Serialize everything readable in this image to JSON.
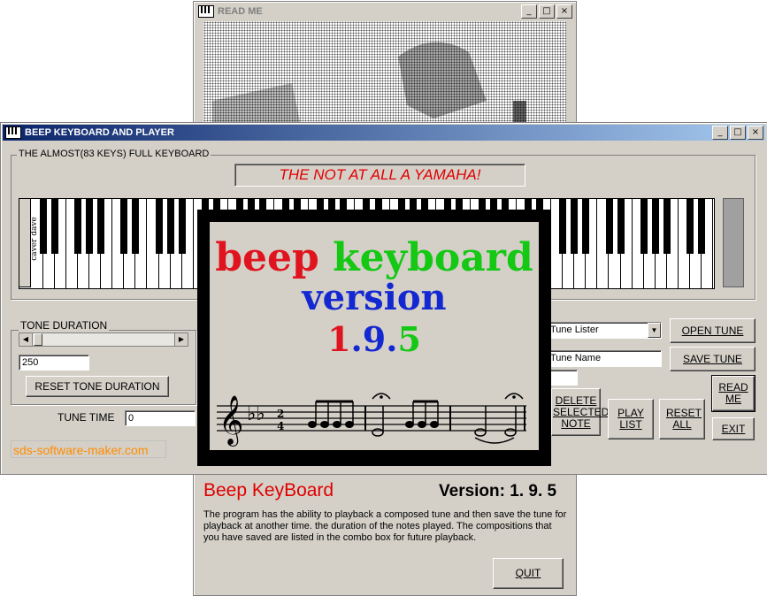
{
  "readme_window": {
    "title": "READ ME",
    "heading": "Beep KeyBoard",
    "version": "Version: 1. 9. 5",
    "description": "The program has the ability to playback a composed tune and then save the tune for playback at  another time.  the duration of the notes played.  The compositions that you have saved are listed in the combo box for future playback.",
    "quit_label": "QUIT"
  },
  "main_window": {
    "title": "BEEP KEYBOARD AND PLAYER",
    "keyboard_group_label": "THE ALMOST(83 KEYS) FULL KEYBOARD",
    "banner": "THE NOT AT ALL A YAMAHA!",
    "side_label": "caver dave",
    "tone_group_label": "TONE DURATION",
    "tone_value": "250",
    "reset_tone_label": "RESET TONE DURATION",
    "tune_time_label": "TUNE TIME",
    "tune_time_value": "0",
    "website": "sds-software-maker.com",
    "tune_lister_value": "Tune Lister",
    "tune_name_value": "Tune Name",
    "open_tune_label": "OPEN TUNE",
    "save_tune_label": "SAVE TUNE",
    "read_me_label": "READ ME",
    "delete_label": "DELETE SELECTED NOTE",
    "play_list_label": "PLAY LIST",
    "reset_all_label": "RESET ALL",
    "exit_label": "EXIT"
  },
  "splash": {
    "word1": "beep",
    "word2": "keyboard",
    "line2": "version",
    "ver_1": "1",
    "ver_2": "9",
    "ver_3": "5",
    "colors": {
      "red": "#e0141e",
      "green": "#14c814",
      "blue": "#1428d2"
    }
  },
  "title_buttons": {
    "minimize": "_",
    "maximize": "□",
    "close": "×"
  }
}
